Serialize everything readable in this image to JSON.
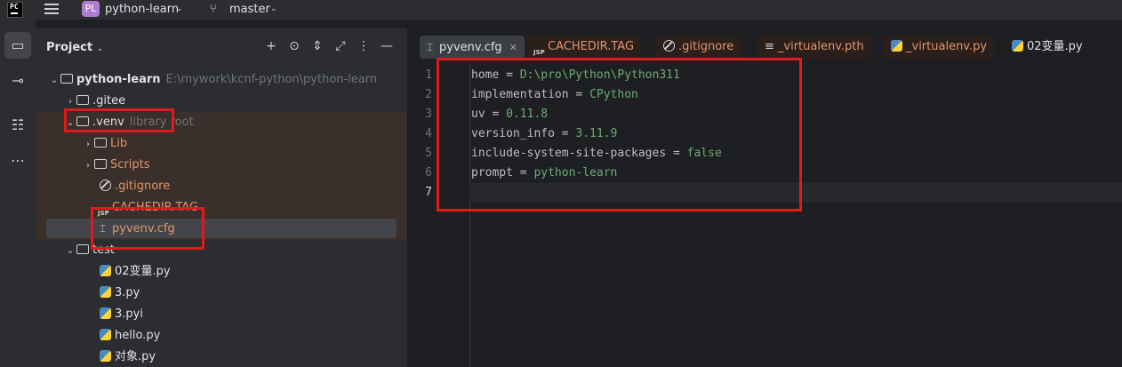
{
  "titlebar": {
    "logo_text": "PC",
    "project_badge": "PL",
    "project_name": "python-learn",
    "branch_name": "master"
  },
  "panel": {
    "title": "Project"
  },
  "tree": [
    {
      "label": "python-learn",
      "hint": "E:\\mywork\\kcnf-python\\python-learn",
      "icon": "module-folder-icon",
      "arrow": "⌄"
    },
    {
      "label": ".gitee",
      "icon": "folder-icon",
      "arrow": "›"
    },
    {
      "label": ".venv",
      "hint": "library root",
      "icon": "folder-icon",
      "arrow": "⌄"
    },
    {
      "label": "Lib",
      "icon": "folder-icon",
      "arrow": "›"
    },
    {
      "label": "Scripts",
      "icon": "folder-icon",
      "arrow": "›"
    },
    {
      "label": ".gitignore",
      "icon": "gitignore-icon"
    },
    {
      "label": "CACHEDIR.TAG",
      "icon": "jsp-file-icon",
      "icon_text": "JSP"
    },
    {
      "label": "pyvenv.cfg",
      "icon": "config-file-icon"
    },
    {
      "label": "test",
      "icon": "folder-icon",
      "arrow": "⌄"
    },
    {
      "label": "02变量.py",
      "icon": "python-file-icon"
    },
    {
      "label": "3.py",
      "icon": "python-file-icon"
    },
    {
      "label": "3.pyi",
      "icon": "python-file-icon"
    },
    {
      "label": "hello.py",
      "icon": "python-file-icon"
    },
    {
      "label": "对象.py",
      "icon": "python-file-icon"
    }
  ],
  "tabs": [
    {
      "label": "pyvenv.cfg",
      "active": true
    },
    {
      "label": "CACHEDIR.TAG",
      "icon_text": "JSP"
    },
    {
      "label": ".gitignore"
    },
    {
      "label": "_virtualenv.pth"
    },
    {
      "label": "_virtualenv.py"
    },
    {
      "label": "02变量.py"
    }
  ],
  "editor": {
    "lines": [
      {
        "n": "1",
        "key": "home",
        "value": "D:\\pro\\Python\\Python311"
      },
      {
        "n": "2",
        "key": "implementation",
        "value": "CPython"
      },
      {
        "n": "3",
        "key": "uv",
        "value": "0.11.8"
      },
      {
        "n": "4",
        "key": "version_info",
        "value": "3.11.9"
      },
      {
        "n": "5",
        "key": "include-system-site-packages",
        "value": "false"
      },
      {
        "n": "6",
        "key": "prompt",
        "value": "python-learn"
      },
      {
        "n": "7",
        "key": "",
        "value": ""
      }
    ],
    "separator": " = "
  },
  "colors": {
    "highlight_box": "#e01a1a",
    "value_text": "#6aab73",
    "library_file_text": "#e0956b"
  }
}
